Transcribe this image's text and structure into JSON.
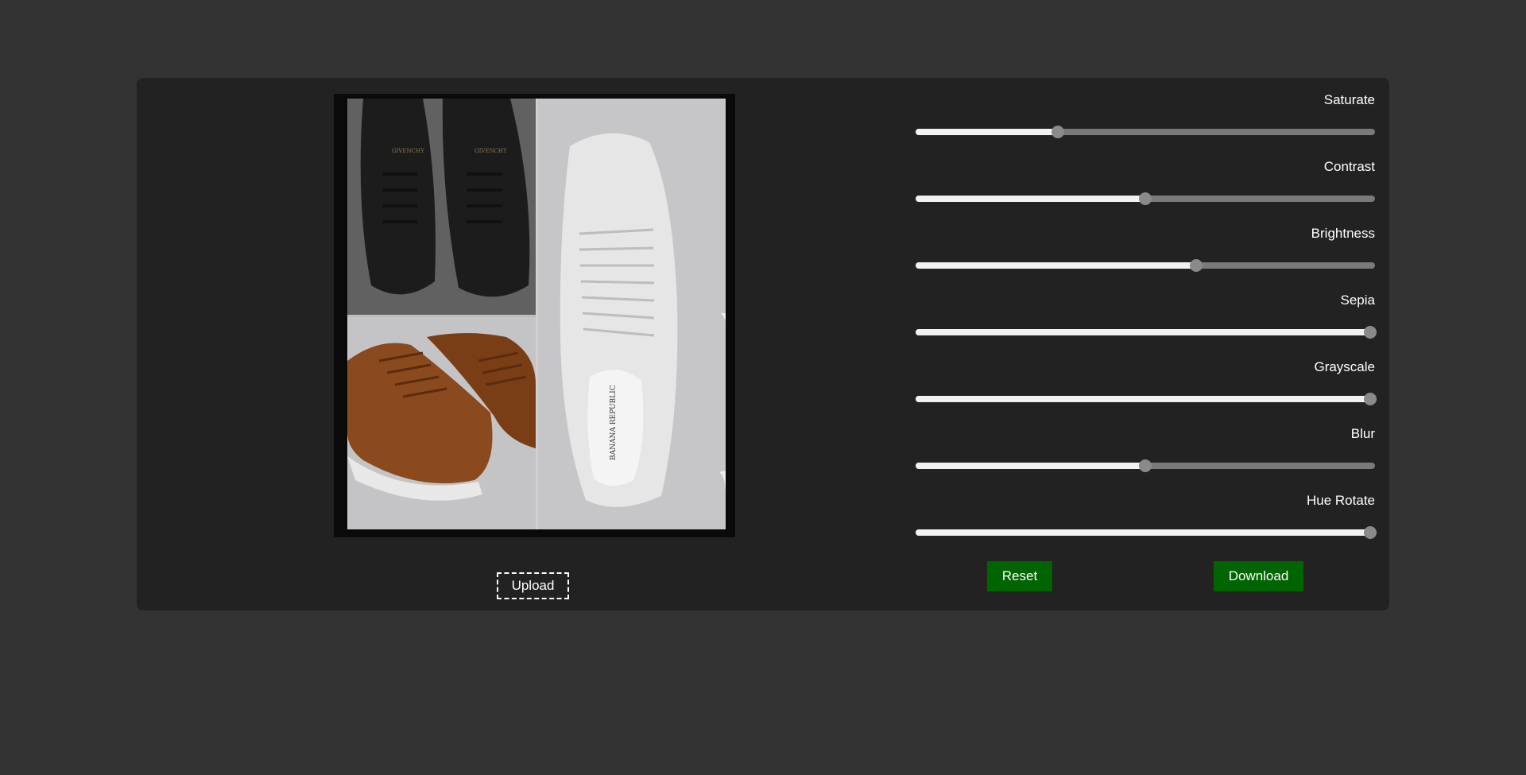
{
  "editor": {
    "upload_label": "Upload",
    "reset_label": "Reset",
    "download_label": "Download"
  },
  "image": {
    "brand_text_1": "GIVENCHY",
    "brand_text_2": "GIVENCHY",
    "insole_text": "BANANA REPUBLIC"
  },
  "sliders": [
    {
      "label": "Saturate",
      "fraction": 0.31
    },
    {
      "label": "Contrast",
      "fraction": 0.5
    },
    {
      "label": "Brightness",
      "fraction": 0.61
    },
    {
      "label": "Sepia",
      "fraction": 0.99
    },
    {
      "label": "Grayscale",
      "fraction": 0.99
    },
    {
      "label": "Blur",
      "fraction": 0.5
    },
    {
      "label": "Hue Rotate",
      "fraction": 0.99
    }
  ],
  "colors": {
    "background": "#333333",
    "panel": "#222222",
    "button": "#006400",
    "track_filled": "#f2f2f2",
    "track_empty": "#7a7a7a",
    "thumb": "#8a8a8a"
  }
}
